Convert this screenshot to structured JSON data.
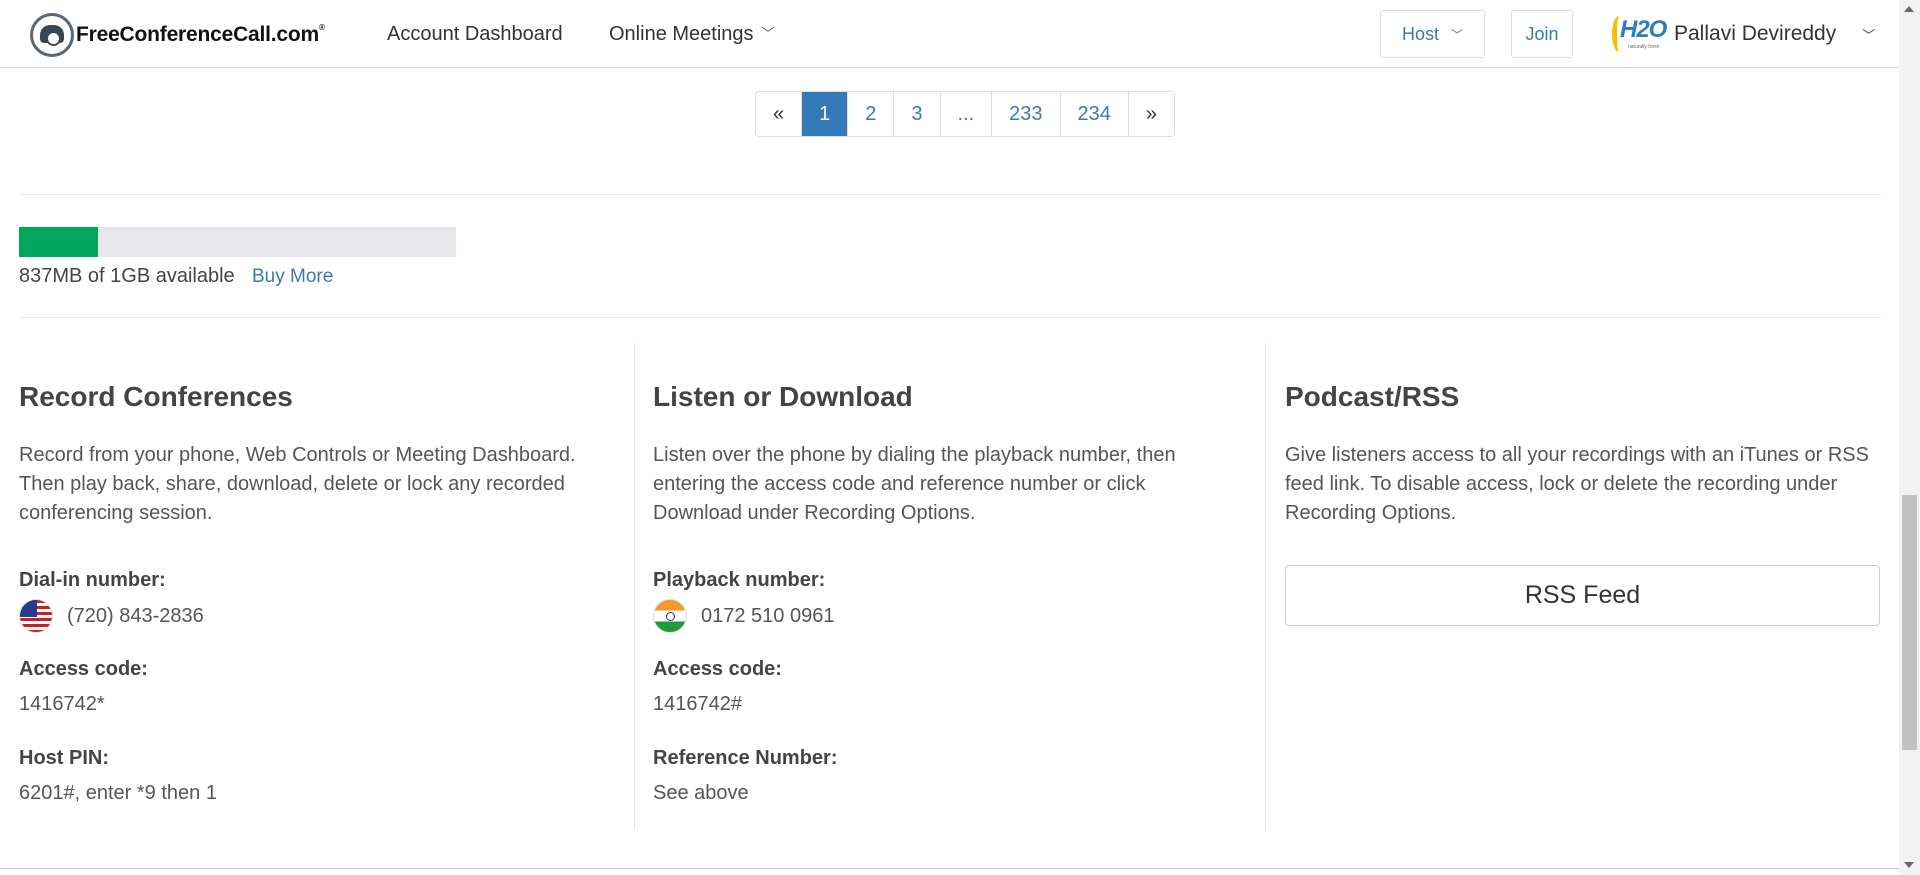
{
  "header": {
    "logo_text": "FreeConferenceCall.com",
    "logo_mark": "®",
    "nav": {
      "account_dashboard": "Account Dashboard",
      "online_meetings": "Online Meetings"
    },
    "host_label": "Host",
    "join_label": "Join",
    "profile": {
      "avatar_text": "H2O",
      "avatar_tagline": "naturally fresh",
      "name": "Pallavi Devireddy"
    }
  },
  "pagination": {
    "prev": "«",
    "pages": [
      "1",
      "2",
      "3",
      "...",
      "233",
      "234"
    ],
    "active_page": "1",
    "next": "»"
  },
  "storage": {
    "used_fraction": 0.18,
    "text": "837MB of 1GB available",
    "buy_more": "Buy More",
    "fill_color": "#00a65a"
  },
  "record": {
    "title": "Record Conferences",
    "description": "Record from your phone, Web Controls or Meeting Dashboard. Then play back, share, download, delete or lock any recorded conferencing session.",
    "dialin_label": "Dial-in number:",
    "dialin_flag": "us-flag-icon",
    "dialin_value": "(720) 843-2836",
    "access_label": "Access code:",
    "access_value": "1416742*",
    "pin_label": "Host PIN:",
    "pin_value": "6201#, enter *9 then 1"
  },
  "listen": {
    "title": "Listen or Download",
    "description": "Listen over the phone by dialing the playback number, then entering the access code and reference number or click Download under Recording Options.",
    "playback_label": "Playback number:",
    "playback_flag": "india-flag-icon",
    "playback_value": "0172 510 0961",
    "access_label": "Access code:",
    "access_value": "1416742#",
    "reference_label": "Reference Number:",
    "reference_value": "See above"
  },
  "podcast": {
    "title": "Podcast/RSS",
    "description": "Give listeners access to all your recordings with an iTunes or RSS feed link. To disable access, lock or delete the recording under Recording Options.",
    "rss_button": "RSS Feed"
  },
  "colors": {
    "link": "#3a78b5",
    "active_page_bg": "#337ab7",
    "heading": "#444444"
  }
}
